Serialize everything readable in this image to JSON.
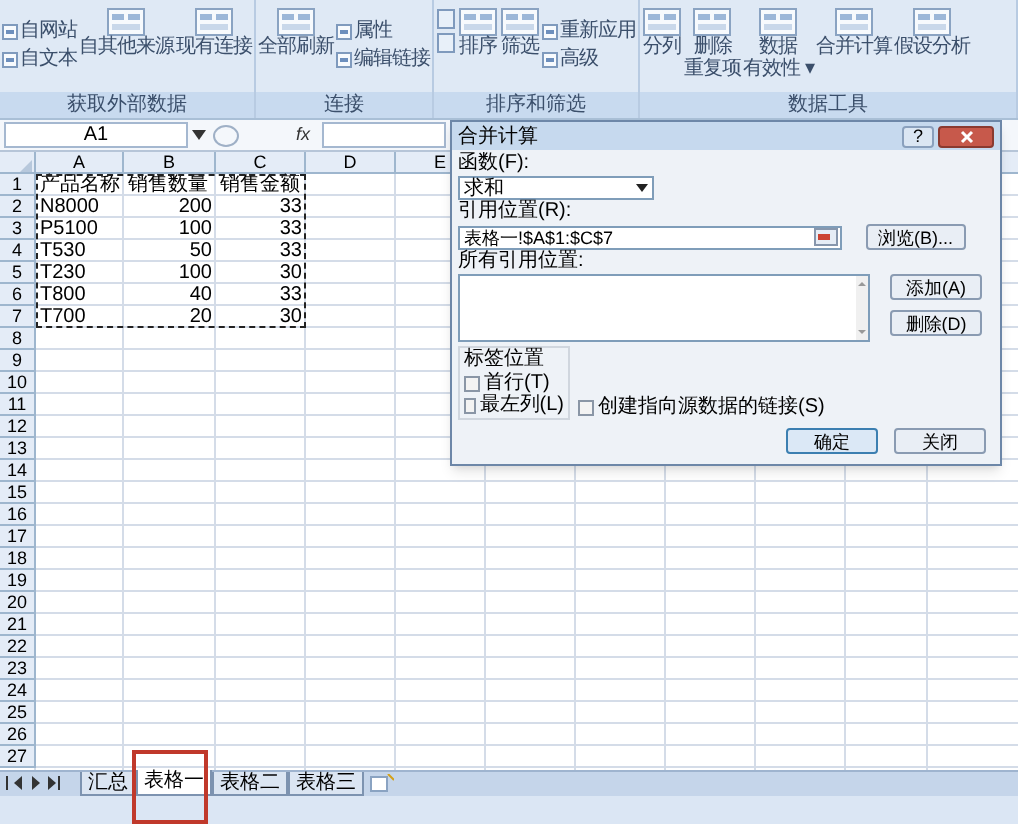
{
  "ribbon": {
    "groups": [
      {
        "label": "获取外部数据",
        "small_items": [
          "自网站",
          "自文本"
        ],
        "large_items": [
          [
            "自其他来源"
          ],
          [
            "现有连接"
          ]
        ]
      },
      {
        "label": "连接",
        "large_items": [
          [
            "全部刷新"
          ]
        ],
        "small_items": [
          "属性",
          "编辑链接"
        ]
      },
      {
        "label": "排序和筛选",
        "large_items": [
          [
            "排序"
          ],
          [
            "筛选"
          ]
        ],
        "small_items": [
          "重新应用",
          "高级"
        ]
      },
      {
        "label": "数据工具",
        "large_items": [
          [
            "分列"
          ],
          [
            "删除",
            "重复项"
          ],
          [
            "数据",
            "有效性 ▾"
          ],
          [
            "合并计算"
          ],
          [
            "假设分析"
          ]
        ]
      }
    ]
  },
  "formula_bar": {
    "name_box": "A1",
    "fx": "fx"
  },
  "sheet": {
    "columns": [
      "A",
      "B",
      "C",
      "D",
      "E"
    ],
    "copy_marquee": true,
    "rows": [
      {
        "header": "1",
        "cells": [
          "产品名称",
          "销售数量",
          "销售金额"
        ]
      },
      {
        "header": "2",
        "cells": [
          "N8000",
          "200",
          "33"
        ]
      },
      {
        "header": "3",
        "cells": [
          "P5100",
          "100",
          "33"
        ]
      },
      {
        "header": "4",
        "cells": [
          "T530",
          "50",
          "33"
        ]
      },
      {
        "header": "5",
        "cells": [
          "T230",
          "100",
          "30"
        ]
      },
      {
        "header": "6",
        "cells": [
          "T800",
          "40",
          "33"
        ]
      },
      {
        "header": "7",
        "cells": [
          "T700",
          "20",
          "30"
        ]
      },
      {
        "header": "8"
      },
      {
        "header": "9"
      },
      {
        "header": "10"
      },
      {
        "header": "11"
      },
      {
        "header": "12"
      },
      {
        "header": "13"
      },
      {
        "header": "14"
      },
      {
        "header": "15"
      },
      {
        "header": "16"
      },
      {
        "header": "17"
      },
      {
        "header": "18"
      },
      {
        "header": "19"
      },
      {
        "header": "20"
      },
      {
        "header": "21"
      },
      {
        "header": "22"
      },
      {
        "header": "23"
      },
      {
        "header": "24"
      },
      {
        "header": "25"
      },
      {
        "header": "26"
      },
      {
        "header": "27"
      }
    ]
  },
  "sheet_tabs": [
    {
      "label": "汇总",
      "selected": false
    },
    {
      "label": "表格一",
      "selected": true
    },
    {
      "label": "表格二",
      "selected": false
    },
    {
      "label": "表格三",
      "selected": false
    }
  ],
  "dialog": {
    "title": "合并计算",
    "help": "?",
    "function_label": "函数(F):",
    "function_value": "求和",
    "reference_label": "引用位置(R):",
    "reference_value": "表格一!$A$1:$C$7",
    "browse_button": "浏览(B)...",
    "all_references_label": "所有引用位置:",
    "add_button": "添加(A)",
    "delete_button": "删除(D)",
    "label_group": "标签位置",
    "checkboxes": [
      {
        "label": "首行(T)",
        "checked": false
      },
      {
        "label": "最左列(L)",
        "checked": false
      },
      {
        "label": "创建指向源数据的链接(S)",
        "checked": false
      }
    ],
    "ok_button": "确定",
    "close_button": "关闭"
  }
}
